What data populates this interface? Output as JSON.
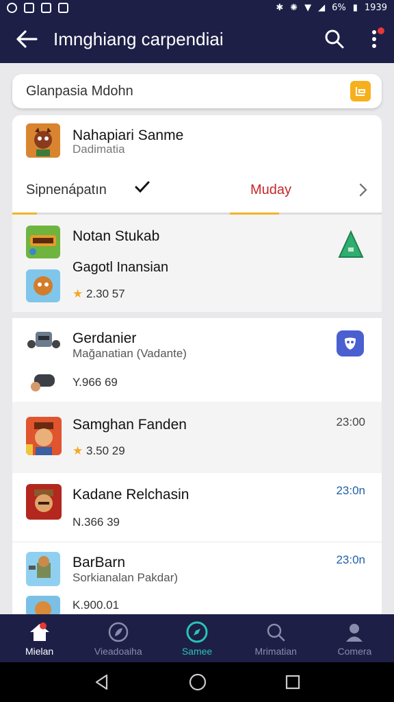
{
  "status_bar": {
    "time": "1939",
    "battery": "6%"
  },
  "app_bar": {
    "title": "Imnghiang carpendiai"
  },
  "search": {
    "text": "Glanpasia Mdohn"
  },
  "featured": {
    "title": "Nahapiari Sanme",
    "subtitle": "Dadimatia",
    "selector_label": "Sipnenápatın",
    "selector_value": "Muday"
  },
  "items": [
    {
      "title": "Notan Stukab",
      "line2": "Gagotl Inansian",
      "rating": "2.30 57",
      "star": "★"
    },
    {
      "title": "Gerdanier",
      "subtitle": "Mağanatian (Vadante)",
      "meta": "Y.966 69"
    },
    {
      "title": "Samghan Fanden",
      "rating": "3.50 29",
      "star": "★",
      "time": "23:00"
    },
    {
      "title": "Kadane Relchasin",
      "meta": "N.366 39",
      "time": "23:0n"
    },
    {
      "title": "BarBarn",
      "subtitle": "Sorkianalan Pakdar)",
      "meta": "K.900.01",
      "time": "23:0n"
    }
  ],
  "bottom_nav": [
    {
      "label": "Mielan"
    },
    {
      "label": "Vieadoaiha"
    },
    {
      "label": "Samee"
    },
    {
      "label": "Mrimatian"
    },
    {
      "label": "Comera"
    }
  ],
  "colors": {
    "bar": "#1d1f47",
    "accent_teal": "#29c4b4",
    "accent_red": "#c62828",
    "time_blue": "#1e5fa8"
  }
}
